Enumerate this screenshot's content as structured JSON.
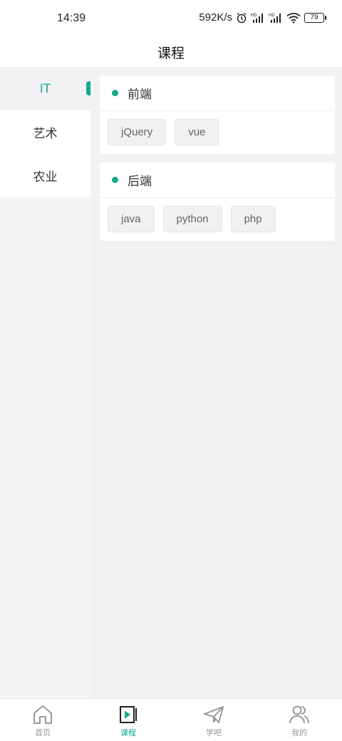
{
  "status_bar": {
    "time": "14:39",
    "net_speed": "592K/s",
    "battery": "79",
    "icons": [
      "alarm-icon",
      "hd-signal-icon",
      "hd-signal-icon",
      "wifi-icon",
      "battery-icon"
    ]
  },
  "header": {
    "title": "课程"
  },
  "sidebar": {
    "items": [
      {
        "label": "IT",
        "active": true
      },
      {
        "label": "艺术",
        "active": false
      },
      {
        "label": "农业",
        "active": false
      }
    ]
  },
  "categories": [
    {
      "title": "前端",
      "tags": [
        "jQuery",
        "vue"
      ]
    },
    {
      "title": "后端",
      "tags": [
        "java",
        "python",
        "php"
      ]
    }
  ],
  "tabbar": {
    "tabs": [
      {
        "label": "首页",
        "icon": "home-icon",
        "active": false
      },
      {
        "label": "课程",
        "icon": "video-icon",
        "active": true
      },
      {
        "label": "学吧",
        "icon": "paper-plane-icon",
        "active": false
      },
      {
        "label": "我的",
        "icon": "users-icon",
        "active": false
      }
    ]
  },
  "colors": {
    "accent": "#18a98a",
    "background": "#f2f1f4"
  }
}
